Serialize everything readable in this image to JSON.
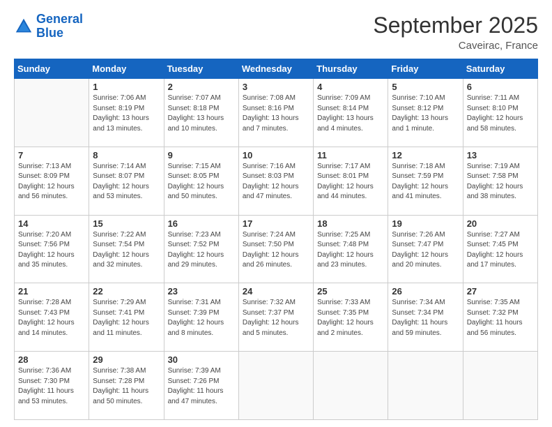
{
  "logo": {
    "text_general": "General",
    "text_blue": "Blue"
  },
  "header": {
    "title": "September 2025",
    "location": "Caveirac, France"
  },
  "weekdays": [
    "Sunday",
    "Monday",
    "Tuesday",
    "Wednesday",
    "Thursday",
    "Friday",
    "Saturday"
  ],
  "weeks": [
    [
      {
        "day": "",
        "empty": true
      },
      {
        "day": "1",
        "sunrise": "7:06 AM",
        "sunset": "8:19 PM",
        "daylight": "13 hours and 13 minutes."
      },
      {
        "day": "2",
        "sunrise": "7:07 AM",
        "sunset": "8:18 PM",
        "daylight": "13 hours and 10 minutes."
      },
      {
        "day": "3",
        "sunrise": "7:08 AM",
        "sunset": "8:16 PM",
        "daylight": "13 hours and 7 minutes."
      },
      {
        "day": "4",
        "sunrise": "7:09 AM",
        "sunset": "8:14 PM",
        "daylight": "13 hours and 4 minutes."
      },
      {
        "day": "5",
        "sunrise": "7:10 AM",
        "sunset": "8:12 PM",
        "daylight": "13 hours and 1 minute."
      },
      {
        "day": "6",
        "sunrise": "7:11 AM",
        "sunset": "8:10 PM",
        "daylight": "12 hours and 58 minutes."
      }
    ],
    [
      {
        "day": "7",
        "sunrise": "7:13 AM",
        "sunset": "8:09 PM",
        "daylight": "12 hours and 56 minutes."
      },
      {
        "day": "8",
        "sunrise": "7:14 AM",
        "sunset": "8:07 PM",
        "daylight": "12 hours and 53 minutes."
      },
      {
        "day": "9",
        "sunrise": "7:15 AM",
        "sunset": "8:05 PM",
        "daylight": "12 hours and 50 minutes."
      },
      {
        "day": "10",
        "sunrise": "7:16 AM",
        "sunset": "8:03 PM",
        "daylight": "12 hours and 47 minutes."
      },
      {
        "day": "11",
        "sunrise": "7:17 AM",
        "sunset": "8:01 PM",
        "daylight": "12 hours and 44 minutes."
      },
      {
        "day": "12",
        "sunrise": "7:18 AM",
        "sunset": "7:59 PM",
        "daylight": "12 hours and 41 minutes."
      },
      {
        "day": "13",
        "sunrise": "7:19 AM",
        "sunset": "7:58 PM",
        "daylight": "12 hours and 38 minutes."
      }
    ],
    [
      {
        "day": "14",
        "sunrise": "7:20 AM",
        "sunset": "7:56 PM",
        "daylight": "12 hours and 35 minutes."
      },
      {
        "day": "15",
        "sunrise": "7:22 AM",
        "sunset": "7:54 PM",
        "daylight": "12 hours and 32 minutes."
      },
      {
        "day": "16",
        "sunrise": "7:23 AM",
        "sunset": "7:52 PM",
        "daylight": "12 hours and 29 minutes."
      },
      {
        "day": "17",
        "sunrise": "7:24 AM",
        "sunset": "7:50 PM",
        "daylight": "12 hours and 26 minutes."
      },
      {
        "day": "18",
        "sunrise": "7:25 AM",
        "sunset": "7:48 PM",
        "daylight": "12 hours and 23 minutes."
      },
      {
        "day": "19",
        "sunrise": "7:26 AM",
        "sunset": "7:47 PM",
        "daylight": "12 hours and 20 minutes."
      },
      {
        "day": "20",
        "sunrise": "7:27 AM",
        "sunset": "7:45 PM",
        "daylight": "12 hours and 17 minutes."
      }
    ],
    [
      {
        "day": "21",
        "sunrise": "7:28 AM",
        "sunset": "7:43 PM",
        "daylight": "12 hours and 14 minutes."
      },
      {
        "day": "22",
        "sunrise": "7:29 AM",
        "sunset": "7:41 PM",
        "daylight": "12 hours and 11 minutes."
      },
      {
        "day": "23",
        "sunrise": "7:31 AM",
        "sunset": "7:39 PM",
        "daylight": "12 hours and 8 minutes."
      },
      {
        "day": "24",
        "sunrise": "7:32 AM",
        "sunset": "7:37 PM",
        "daylight": "12 hours and 5 minutes."
      },
      {
        "day": "25",
        "sunrise": "7:33 AM",
        "sunset": "7:35 PM",
        "daylight": "12 hours and 2 minutes."
      },
      {
        "day": "26",
        "sunrise": "7:34 AM",
        "sunset": "7:34 PM",
        "daylight": "11 hours and 59 minutes."
      },
      {
        "day": "27",
        "sunrise": "7:35 AM",
        "sunset": "7:32 PM",
        "daylight": "11 hours and 56 minutes."
      }
    ],
    [
      {
        "day": "28",
        "sunrise": "7:36 AM",
        "sunset": "7:30 PM",
        "daylight": "11 hours and 53 minutes."
      },
      {
        "day": "29",
        "sunrise": "7:38 AM",
        "sunset": "7:28 PM",
        "daylight": "11 hours and 50 minutes."
      },
      {
        "day": "30",
        "sunrise": "7:39 AM",
        "sunset": "7:26 PM",
        "daylight": "11 hours and 47 minutes."
      },
      {
        "day": "",
        "empty": true
      },
      {
        "day": "",
        "empty": true
      },
      {
        "day": "",
        "empty": true
      },
      {
        "day": "",
        "empty": true
      }
    ]
  ]
}
